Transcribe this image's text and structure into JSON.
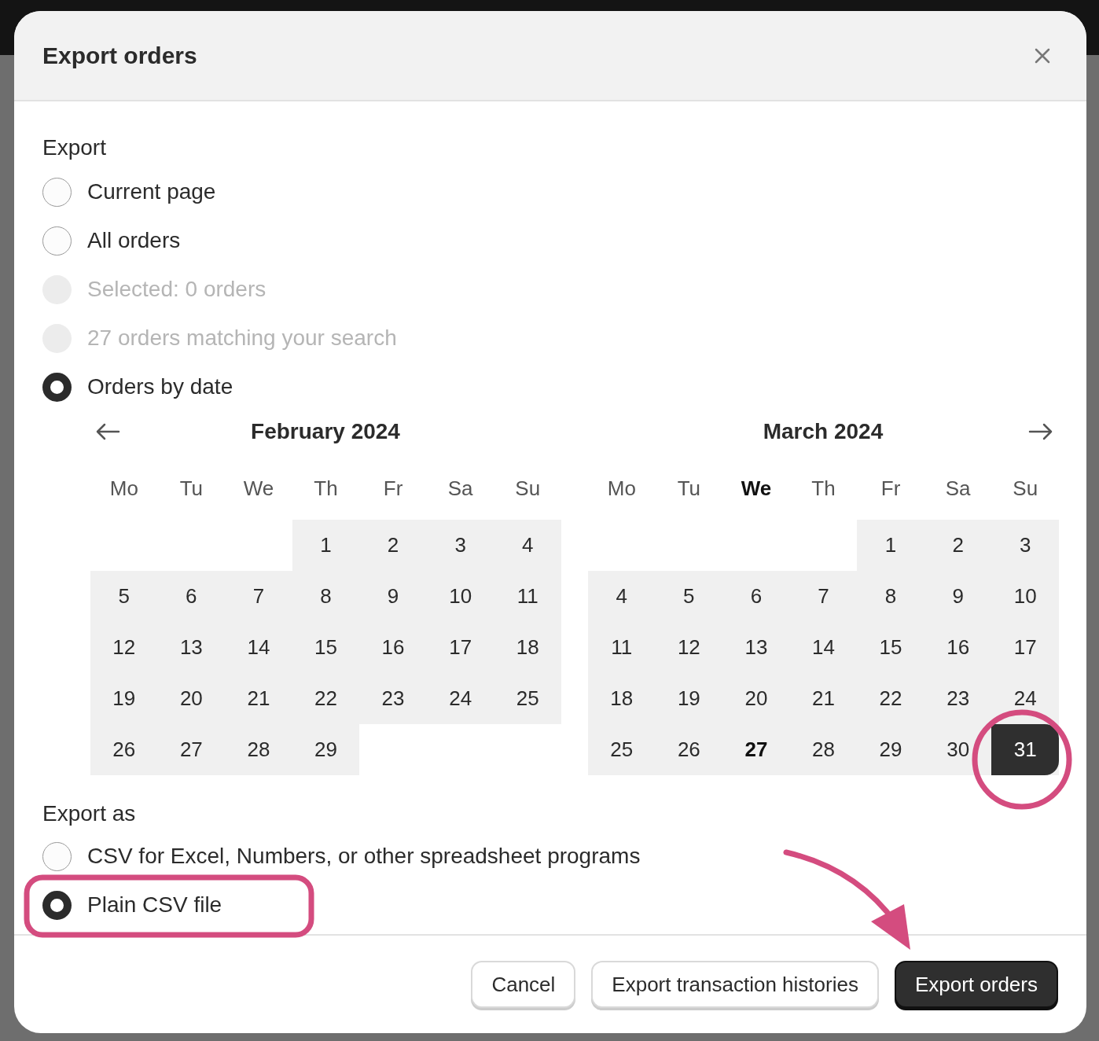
{
  "dialog": {
    "title": "Export orders",
    "export_label": "Export",
    "scope_options": [
      {
        "label": "Current page",
        "selected": false,
        "disabled": false
      },
      {
        "label": "All orders",
        "selected": false,
        "disabled": false
      },
      {
        "label": "Selected: 0 orders",
        "selected": false,
        "disabled": true
      },
      {
        "label": "27 orders matching your search",
        "selected": false,
        "disabled": true
      },
      {
        "label": "Orders by date",
        "selected": true,
        "disabled": false
      }
    ],
    "months": [
      {
        "title": "February 2024",
        "weekdays": [
          {
            "label": "Mo",
            "today": false
          },
          {
            "label": "Tu",
            "today": false
          },
          {
            "label": "We",
            "today": false
          },
          {
            "label": "Th",
            "today": false
          },
          {
            "label": "Fr",
            "today": false
          },
          {
            "label": "Sa",
            "today": false
          },
          {
            "label": "Su",
            "today": false
          }
        ],
        "weeks": [
          [
            {
              "kind": "blank"
            },
            {
              "kind": "blank"
            },
            {
              "kind": "blank"
            },
            {
              "label": "1",
              "selected": false,
              "today": false
            },
            {
              "label": "2",
              "selected": false,
              "today": false
            },
            {
              "label": "3",
              "selected": false,
              "today": false
            },
            {
              "label": "4",
              "selected": false,
              "today": false
            }
          ],
          [
            {
              "label": "5",
              "selected": false,
              "today": false
            },
            {
              "label": "6",
              "selected": false,
              "today": false
            },
            {
              "label": "7",
              "selected": false,
              "today": false
            },
            {
              "label": "8",
              "selected": false,
              "today": false
            },
            {
              "label": "9",
              "selected": false,
              "today": false
            },
            {
              "label": "10",
              "selected": false,
              "today": false
            },
            {
              "label": "11",
              "selected": false,
              "today": false
            }
          ],
          [
            {
              "label": "12",
              "selected": false,
              "today": false
            },
            {
              "label": "13",
              "selected": false,
              "today": false
            },
            {
              "label": "14",
              "selected": false,
              "today": false
            },
            {
              "label": "15",
              "selected": false,
              "today": false
            },
            {
              "label": "16",
              "selected": false,
              "today": false
            },
            {
              "label": "17",
              "selected": false,
              "today": false
            },
            {
              "label": "18",
              "selected": false,
              "today": false
            }
          ],
          [
            {
              "label": "19",
              "selected": false,
              "today": false
            },
            {
              "label": "20",
              "selected": false,
              "today": false
            },
            {
              "label": "21",
              "selected": false,
              "today": false
            },
            {
              "label": "22",
              "selected": false,
              "today": false
            },
            {
              "label": "23",
              "selected": false,
              "today": false
            },
            {
              "label": "24",
              "selected": false,
              "today": false
            },
            {
              "label": "25",
              "selected": false,
              "today": false
            }
          ],
          [
            {
              "label": "26",
              "selected": false,
              "today": false
            },
            {
              "label": "27",
              "selected": false,
              "today": false
            },
            {
              "label": "28",
              "selected": false,
              "today": false
            },
            {
              "label": "29",
              "selected": false,
              "today": false
            },
            {
              "kind": "blank"
            },
            {
              "kind": "blank"
            },
            {
              "kind": "blank"
            }
          ]
        ]
      },
      {
        "title": "March 2024",
        "weekdays": [
          {
            "label": "Mo",
            "today": false
          },
          {
            "label": "Tu",
            "today": false
          },
          {
            "label": "We",
            "today": true
          },
          {
            "label": "Th",
            "today": false
          },
          {
            "label": "Fr",
            "today": false
          },
          {
            "label": "Sa",
            "today": false
          },
          {
            "label": "Su",
            "today": false
          }
        ],
        "weeks": [
          [
            {
              "kind": "blank"
            },
            {
              "kind": "blank"
            },
            {
              "kind": "blank"
            },
            {
              "kind": "blank"
            },
            {
              "label": "1",
              "selected": false,
              "today": false
            },
            {
              "label": "2",
              "selected": false,
              "today": false
            },
            {
              "label": "3",
              "selected": false,
              "today": false
            }
          ],
          [
            {
              "label": "4",
              "selected": false,
              "today": false
            },
            {
              "label": "5",
              "selected": false,
              "today": false
            },
            {
              "label": "6",
              "selected": false,
              "today": false
            },
            {
              "label": "7",
              "selected": false,
              "today": false
            },
            {
              "label": "8",
              "selected": false,
              "today": false
            },
            {
              "label": "9",
              "selected": false,
              "today": false
            },
            {
              "label": "10",
              "selected": false,
              "today": false
            }
          ],
          [
            {
              "label": "11",
              "selected": false,
              "today": false
            },
            {
              "label": "12",
              "selected": false,
              "today": false
            },
            {
              "label": "13",
              "selected": false,
              "today": false
            },
            {
              "label": "14",
              "selected": false,
              "today": false
            },
            {
              "label": "15",
              "selected": false,
              "today": false
            },
            {
              "label": "16",
              "selected": false,
              "today": false
            },
            {
              "label": "17",
              "selected": false,
              "today": false
            }
          ],
          [
            {
              "label": "18",
              "selected": false,
              "today": false
            },
            {
              "label": "19",
              "selected": false,
              "today": false
            },
            {
              "label": "20",
              "selected": false,
              "today": false
            },
            {
              "label": "21",
              "selected": false,
              "today": false
            },
            {
              "label": "22",
              "selected": false,
              "today": false
            },
            {
              "label": "23",
              "selected": false,
              "today": false
            },
            {
              "label": "24",
              "selected": false,
              "today": false
            }
          ],
          [
            {
              "label": "25",
              "selected": false,
              "today": false
            },
            {
              "label": "26",
              "selected": false,
              "today": false
            },
            {
              "label": "27",
              "selected": false,
              "today": true
            },
            {
              "label": "28",
              "selected": false,
              "today": false
            },
            {
              "label": "29",
              "selected": false,
              "today": false
            },
            {
              "label": "30",
              "selected": false,
              "today": false
            },
            {
              "label": "31",
              "selected": true,
              "today": false
            }
          ]
        ]
      }
    ],
    "export_as_label": "Export as",
    "format_options": [
      {
        "label": "CSV for Excel, Numbers, or other spreadsheet programs",
        "selected": false,
        "disabled": false
      },
      {
        "label": "Plain CSV file",
        "selected": true,
        "disabled": false
      }
    ],
    "buttons": [
      {
        "label": "Cancel",
        "kind": "secondary"
      },
      {
        "label": "Export transaction histories",
        "kind": "secondary"
      },
      {
        "label": "Export orders",
        "kind": "primary"
      }
    ]
  }
}
